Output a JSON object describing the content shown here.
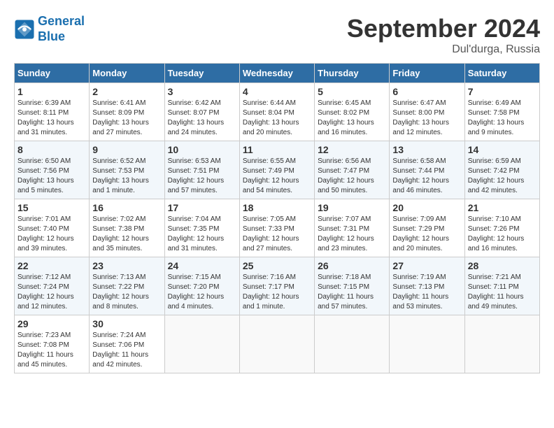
{
  "header": {
    "logo_line1": "General",
    "logo_line2": "Blue",
    "month": "September 2024",
    "location": "Dul'durga, Russia"
  },
  "weekdays": [
    "Sunday",
    "Monday",
    "Tuesday",
    "Wednesday",
    "Thursday",
    "Friday",
    "Saturday"
  ],
  "weeks": [
    [
      {
        "day": "1",
        "info": "Sunrise: 6:39 AM\nSunset: 8:11 PM\nDaylight: 13 hours\nand 31 minutes."
      },
      {
        "day": "2",
        "info": "Sunrise: 6:41 AM\nSunset: 8:09 PM\nDaylight: 13 hours\nand 27 minutes."
      },
      {
        "day": "3",
        "info": "Sunrise: 6:42 AM\nSunset: 8:07 PM\nDaylight: 13 hours\nand 24 minutes."
      },
      {
        "day": "4",
        "info": "Sunrise: 6:44 AM\nSunset: 8:04 PM\nDaylight: 13 hours\nand 20 minutes."
      },
      {
        "day": "5",
        "info": "Sunrise: 6:45 AM\nSunset: 8:02 PM\nDaylight: 13 hours\nand 16 minutes."
      },
      {
        "day": "6",
        "info": "Sunrise: 6:47 AM\nSunset: 8:00 PM\nDaylight: 13 hours\nand 12 minutes."
      },
      {
        "day": "7",
        "info": "Sunrise: 6:49 AM\nSunset: 7:58 PM\nDaylight: 13 hours\nand 9 minutes."
      }
    ],
    [
      {
        "day": "8",
        "info": "Sunrise: 6:50 AM\nSunset: 7:56 PM\nDaylight: 13 hours\nand 5 minutes."
      },
      {
        "day": "9",
        "info": "Sunrise: 6:52 AM\nSunset: 7:53 PM\nDaylight: 13 hours\nand 1 minute."
      },
      {
        "day": "10",
        "info": "Sunrise: 6:53 AM\nSunset: 7:51 PM\nDaylight: 12 hours\nand 57 minutes."
      },
      {
        "day": "11",
        "info": "Sunrise: 6:55 AM\nSunset: 7:49 PM\nDaylight: 12 hours\nand 54 minutes."
      },
      {
        "day": "12",
        "info": "Sunrise: 6:56 AM\nSunset: 7:47 PM\nDaylight: 12 hours\nand 50 minutes."
      },
      {
        "day": "13",
        "info": "Sunrise: 6:58 AM\nSunset: 7:44 PM\nDaylight: 12 hours\nand 46 minutes."
      },
      {
        "day": "14",
        "info": "Sunrise: 6:59 AM\nSunset: 7:42 PM\nDaylight: 12 hours\nand 42 minutes."
      }
    ],
    [
      {
        "day": "15",
        "info": "Sunrise: 7:01 AM\nSunset: 7:40 PM\nDaylight: 12 hours\nand 39 minutes."
      },
      {
        "day": "16",
        "info": "Sunrise: 7:02 AM\nSunset: 7:38 PM\nDaylight: 12 hours\nand 35 minutes."
      },
      {
        "day": "17",
        "info": "Sunrise: 7:04 AM\nSunset: 7:35 PM\nDaylight: 12 hours\nand 31 minutes."
      },
      {
        "day": "18",
        "info": "Sunrise: 7:05 AM\nSunset: 7:33 PM\nDaylight: 12 hours\nand 27 minutes."
      },
      {
        "day": "19",
        "info": "Sunrise: 7:07 AM\nSunset: 7:31 PM\nDaylight: 12 hours\nand 23 minutes."
      },
      {
        "day": "20",
        "info": "Sunrise: 7:09 AM\nSunset: 7:29 PM\nDaylight: 12 hours\nand 20 minutes."
      },
      {
        "day": "21",
        "info": "Sunrise: 7:10 AM\nSunset: 7:26 PM\nDaylight: 12 hours\nand 16 minutes."
      }
    ],
    [
      {
        "day": "22",
        "info": "Sunrise: 7:12 AM\nSunset: 7:24 PM\nDaylight: 12 hours\nand 12 minutes."
      },
      {
        "day": "23",
        "info": "Sunrise: 7:13 AM\nSunset: 7:22 PM\nDaylight: 12 hours\nand 8 minutes."
      },
      {
        "day": "24",
        "info": "Sunrise: 7:15 AM\nSunset: 7:20 PM\nDaylight: 12 hours\nand 4 minutes."
      },
      {
        "day": "25",
        "info": "Sunrise: 7:16 AM\nSunset: 7:17 PM\nDaylight: 12 hours\nand 1 minute."
      },
      {
        "day": "26",
        "info": "Sunrise: 7:18 AM\nSunset: 7:15 PM\nDaylight: 11 hours\nand 57 minutes."
      },
      {
        "day": "27",
        "info": "Sunrise: 7:19 AM\nSunset: 7:13 PM\nDaylight: 11 hours\nand 53 minutes."
      },
      {
        "day": "28",
        "info": "Sunrise: 7:21 AM\nSunset: 7:11 PM\nDaylight: 11 hours\nand 49 minutes."
      }
    ],
    [
      {
        "day": "29",
        "info": "Sunrise: 7:23 AM\nSunset: 7:08 PM\nDaylight: 11 hours\nand 45 minutes."
      },
      {
        "day": "30",
        "info": "Sunrise: 7:24 AM\nSunset: 7:06 PM\nDaylight: 11 hours\nand 42 minutes."
      },
      {
        "day": "",
        "info": ""
      },
      {
        "day": "",
        "info": ""
      },
      {
        "day": "",
        "info": ""
      },
      {
        "day": "",
        "info": ""
      },
      {
        "day": "",
        "info": ""
      }
    ]
  ]
}
